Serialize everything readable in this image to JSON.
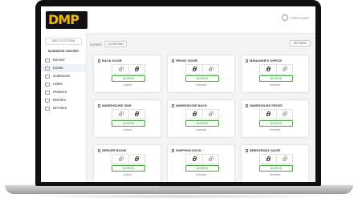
{
  "header": {
    "logo_text": "DMP",
    "user_label": "USER NAME"
  },
  "sidebar": {
    "system_button": "SWITCH SYSTEM",
    "business_name": "BUSINESS CENTER",
    "items": [
      {
        "label": "HISTORY",
        "icon": "history-icon"
      },
      {
        "label": "DOORS",
        "icon": "door-icon",
        "active": true
      },
      {
        "label": "SCHEDULES",
        "icon": "calendar-icon"
      },
      {
        "label": "USERS",
        "icon": "users-icon"
      },
      {
        "label": "PROFILES",
        "icon": "profile-icon"
      },
      {
        "label": "REPORTS",
        "icon": "reports-icon"
      },
      {
        "label": "SETTINGS",
        "icon": "gear-icon"
      }
    ]
  },
  "controls": {
    "doors_label": "DOORS",
    "lockdown_label": "LOCKDOWN",
    "refresh_label": "REFRESH"
  },
  "doors": [
    {
      "name": "BACK DOOR",
      "state": "Locked"
    },
    {
      "name": "FRONT DOOR",
      "state": "Unlocked"
    },
    {
      "name": "MANAGER'S OFFICE",
      "state": "Unlocked"
    },
    {
      "name": "WAREHOUSE SIDE",
      "state": "Locked"
    },
    {
      "name": "WAREHOUSE BACK",
      "state": "Unlocked"
    },
    {
      "name": "WAREHOUSE FRONT",
      "state": "Unlocked"
    },
    {
      "name": "SERVER ROOM",
      "state": "Locked"
    },
    {
      "name": "SHIPPING DOCK",
      "state": "Unlocked"
    },
    {
      "name": "BREEZEWAY DOOR",
      "state": "Unlocked"
    }
  ],
  "access_label": "ACCESS"
}
